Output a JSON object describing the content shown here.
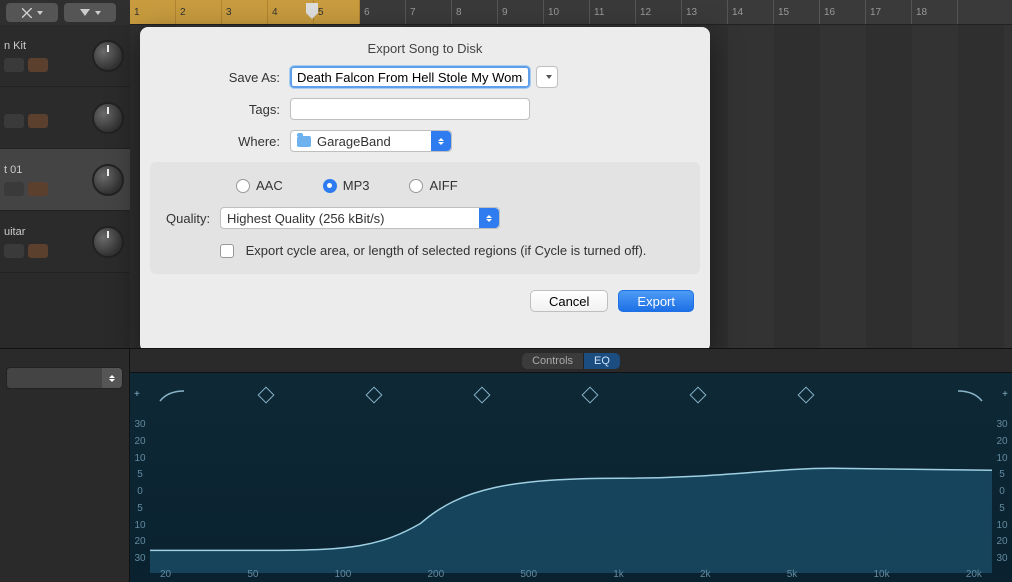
{
  "toolbar": {
    "tool1": "scissors",
    "tool2": "filter"
  },
  "ruler": {
    "numbers": [
      "1",
      "2",
      "3",
      "4",
      "5",
      "6",
      "7",
      "8",
      "9",
      "10",
      "11",
      "12",
      "13",
      "14",
      "15",
      "16",
      "17",
      "18"
    ],
    "cycleEnd": 5
  },
  "tracks": [
    {
      "name": "n Kit",
      "selected": false
    },
    {
      "name": "",
      "selected": false
    },
    {
      "name": "t 01",
      "selected": true
    },
    {
      "name": "uitar",
      "selected": false
    }
  ],
  "dialog": {
    "title": "Export Song to Disk",
    "saveAsLabel": "Save As:",
    "saveAsValue": "Death Falcon From Hell Stole My Woman",
    "tagsLabel": "Tags:",
    "tagsValue": "",
    "whereLabel": "Where:",
    "whereValue": "GarageBand",
    "formats": [
      "AAC",
      "MP3",
      "AIFF"
    ],
    "formatSelected": "MP3",
    "qualityLabel": "Quality:",
    "qualityValue": "Highest Quality (256 kBit/s)",
    "cycleLabel": "Export cycle area, or length of selected regions (if Cycle is turned off).",
    "cancelLabel": "Cancel",
    "exportLabel": "Export"
  },
  "tabs": {
    "controls": "Controls",
    "eq": "EQ",
    "active": "EQ"
  },
  "eq": {
    "dbScale": [
      "30",
      "20",
      "10",
      "5",
      "0",
      "5",
      "10",
      "20",
      "30"
    ],
    "freqs": [
      "20",
      "50",
      "100",
      "200",
      "500",
      "1k",
      "2k",
      "5k",
      "10k",
      "20k"
    ]
  }
}
